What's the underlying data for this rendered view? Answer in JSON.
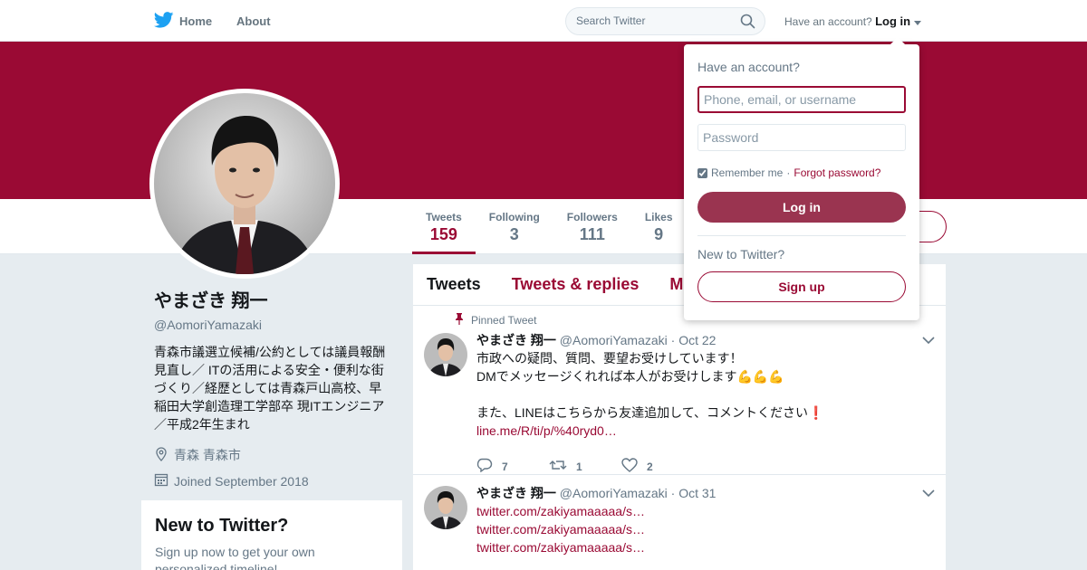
{
  "colors": {
    "brand": "#9a0a34",
    "link": "#9a0a34",
    "twitter_blue": "#1da1f2",
    "background": "#e6ecf0"
  },
  "nav": {
    "home_label": "Home",
    "about_label": "About",
    "search_placeholder": "Search Twitter",
    "have_account_text": "Have an account?",
    "login_label": "Log in"
  },
  "stats": [
    {
      "label": "Tweets",
      "value": "159"
    },
    {
      "label": "Following",
      "value": "3"
    },
    {
      "label": "Followers",
      "value": "111"
    },
    {
      "label": "Likes",
      "value": "9"
    }
  ],
  "profile": {
    "name": "やまざき 翔一",
    "handle": "@AomoriYamazaki",
    "bio": "青森市議選立候補/公約としては議員報酬見直し／ ITの活用による安全・便利な街づくり／経歴としては青森戸山高校、早稲田大学創造理工学部卒 現ITエンジニア／平成2年生まれ",
    "location": "青森 青森市",
    "joined": "Joined September 2018"
  },
  "new_card": {
    "title": "New to Twitter?",
    "text": "Sign up now to get your own personalized timeline!"
  },
  "timeline": {
    "tabs": [
      "Tweets",
      "Tweets & replies",
      "M"
    ],
    "tweets": [
      {
        "pinned_label": "Pinned Tweet",
        "name": "やまざき 翔一",
        "handle": "@AomoriYamazaki",
        "date": "· Oct 22",
        "line1": "市政への疑問、質問、要望お受けしています！",
        "line2": "DMでメッセージくれれば本人がお受けします💪💪💪",
        "line3": "また、LINEはこちらから友達追加して、コメントください❗",
        "link": "line.me/R/ti/p/%40ryd0…",
        "replies": "7",
        "retweets": "1",
        "likes": "2"
      },
      {
        "name": "やまざき 翔一",
        "handle": "@AomoriYamazaki",
        "date": "· Oct 31",
        "links": [
          "twitter.com/zakiyamaaaaa/s…",
          "twitter.com/zakiyamaaaaa/s…",
          "twitter.com/zakiyamaaaaa/s…"
        ]
      }
    ]
  },
  "login_dropdown": {
    "title": "Have an account?",
    "username_placeholder": "Phone, email, or username",
    "password_placeholder": "Password",
    "remember_label": "Remember me",
    "separator": "·",
    "forgot_label": "Forgot password?",
    "login_button": "Log in",
    "new_label": "New to Twitter?",
    "signup_button": "Sign up"
  }
}
